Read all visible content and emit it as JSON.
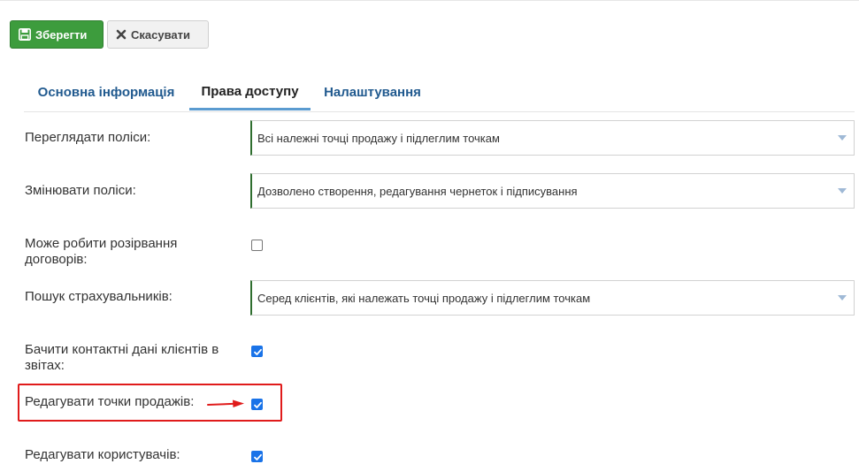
{
  "toolbar": {
    "save_label": "Зберегти",
    "cancel_label": "Скасувати"
  },
  "tabs": [
    {
      "label": "Основна інформація",
      "active": false
    },
    {
      "label": "Права доступу",
      "active": true
    },
    {
      "label": "Налаштування",
      "active": false
    }
  ],
  "form": {
    "view_policies": {
      "label": "Переглядати поліси:",
      "value": "Всі належні точці продажу і підлеглим точкам"
    },
    "edit_policies": {
      "label": "Змінювати поліси:",
      "value": "Дозволено створення, редагування чернеток і підписування"
    },
    "terminate_contracts": {
      "label": "Може робити розірвання договорів:",
      "checked": false
    },
    "search_insurers": {
      "label": "Пошук страхувальників:",
      "value": "Серед клієнтів, які належать точці продажу і підлеглим точкам"
    },
    "contacts_in_reports": {
      "label": "Бачити контактні дані клієнтів в звітах:",
      "checked": true
    },
    "edit_points_of_sale": {
      "label": "Редагувати точки продажів:",
      "checked": true
    },
    "edit_users": {
      "label": "Редагувати користувачів:",
      "checked": true
    }
  },
  "colors": {
    "save_button": "#3d9c3d",
    "tab_link": "#215a8f",
    "tab_active_underline": "#5b9bd0",
    "checkbox_checked": "#1a73e8",
    "annotation_red": "#e01b1b"
  },
  "icons": {
    "save": "floppy-disk-icon",
    "cancel": "close-x-icon",
    "select_toggle": "caret-down-icon",
    "annotation": "red-arrow-icon"
  }
}
